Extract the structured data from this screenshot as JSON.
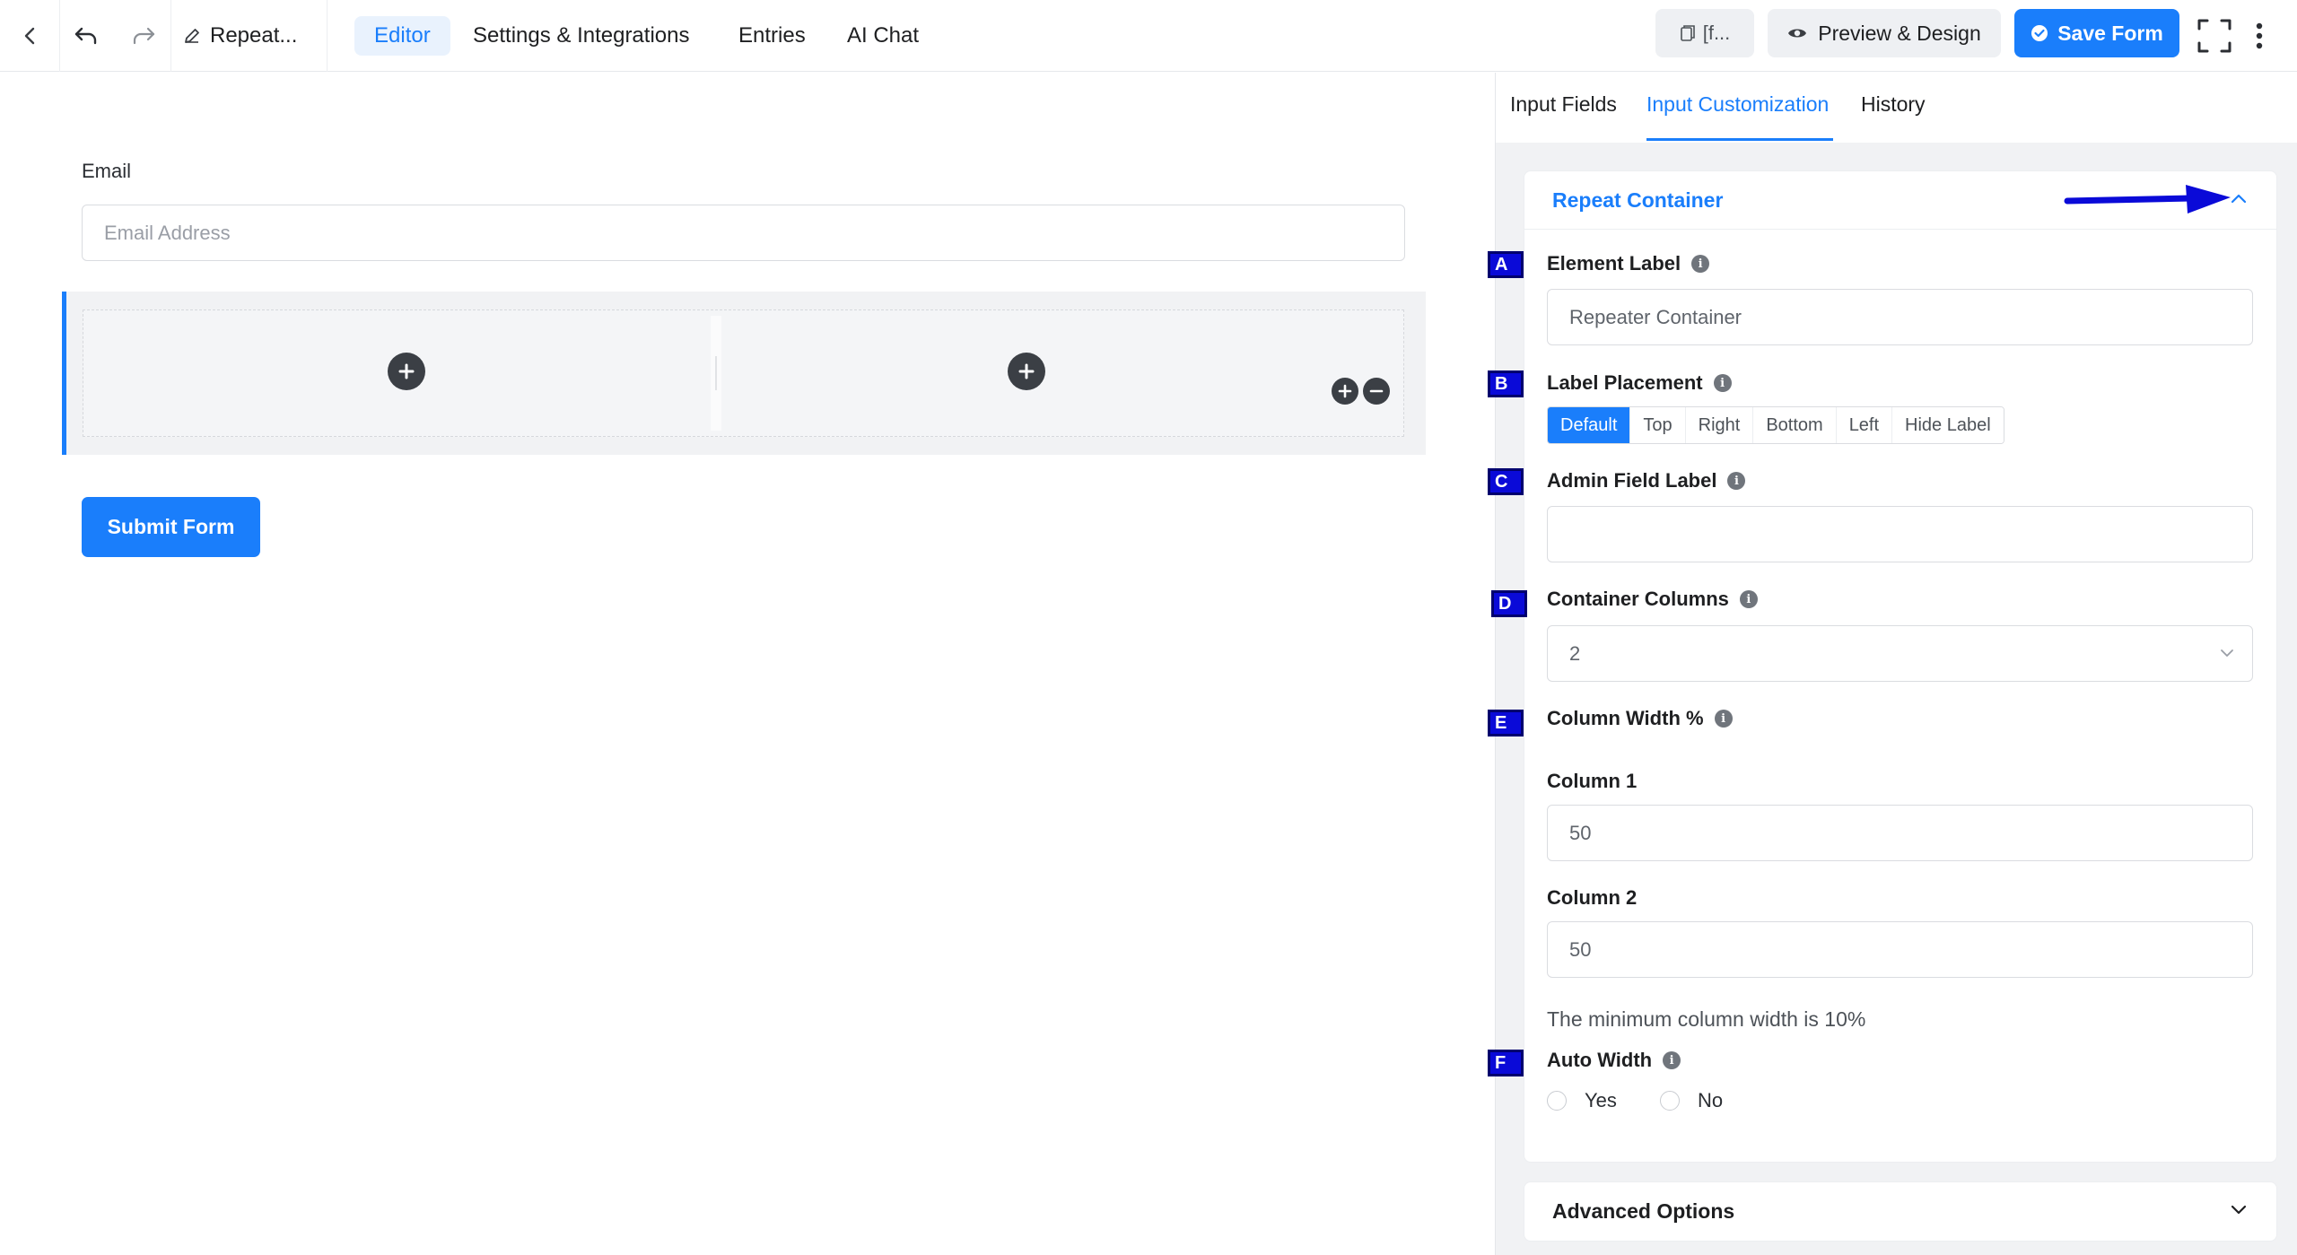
{
  "topbar": {
    "form_name": "Repeat...",
    "tabs": [
      {
        "label": "Editor",
        "active": true
      },
      {
        "label": "Settings & Integrations",
        "active": false
      },
      {
        "label": "Entries",
        "active": false
      },
      {
        "label": "AI Chat",
        "active": false
      }
    ],
    "shortcode_label": "[f...",
    "preview_label": "Preview & Design",
    "save_label": "Save Form",
    "icons": [
      "back-chevron-icon",
      "undo-icon",
      "redo-icon",
      "pencil-icon",
      "fullscreen-icon",
      "more-vertical-icon"
    ]
  },
  "canvas": {
    "email_label": "Email",
    "email_placeholder": "Email Address",
    "repeat_container_columns": 2,
    "submit_label": "Submit Form"
  },
  "panel": {
    "tabs": [
      {
        "label": "Input Fields",
        "active": false
      },
      {
        "label": "Input Customization",
        "active": true
      },
      {
        "label": "History",
        "active": false
      }
    ],
    "section_title": "Repeat Container",
    "element_label": {
      "label": "Element Label",
      "value": "Repeater Container"
    },
    "label_placement": {
      "label": "Label Placement",
      "options": [
        "Default",
        "Top",
        "Right",
        "Bottom",
        "Left",
        "Hide Label"
      ],
      "selected": "Default"
    },
    "admin_field_label": {
      "label": "Admin Field Label",
      "value": ""
    },
    "container_columns": {
      "label": "Container Columns",
      "value": "2"
    },
    "column_width": {
      "label": "Column Width %",
      "columns": [
        {
          "label": "Column 1",
          "value": "50"
        },
        {
          "label": "Column 2",
          "value": "50"
        }
      ],
      "help": "The minimum column width is 10%"
    },
    "auto_width": {
      "label": "Auto Width",
      "options": [
        "Yes",
        "No"
      ]
    },
    "advanced_title": "Advanced Options"
  },
  "markers": [
    "A",
    "B",
    "C",
    "D",
    "E",
    "F"
  ],
  "colors": {
    "accent": "#1a7efb",
    "marker": "#0a0ad8",
    "arrow": "#0a0ad8"
  }
}
